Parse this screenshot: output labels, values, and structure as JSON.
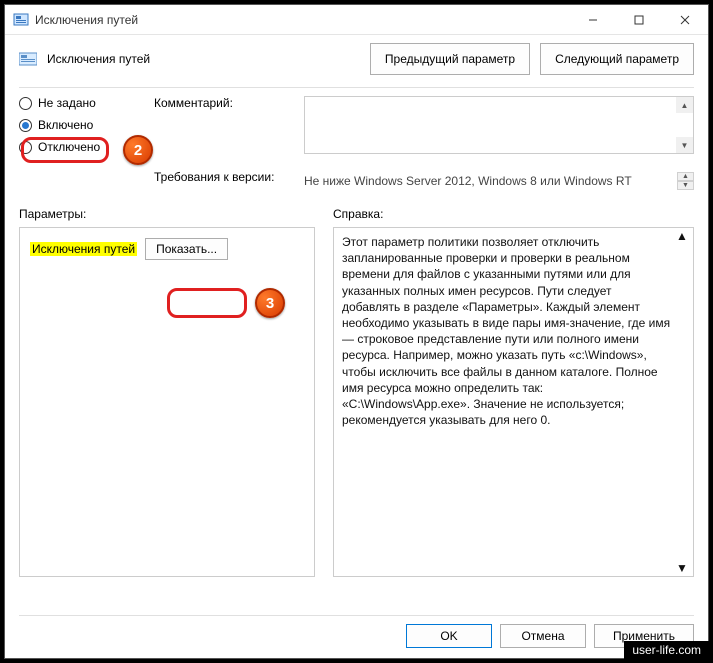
{
  "window": {
    "title": "Исключения путей"
  },
  "toolbar": {
    "label": "Исключения путей",
    "prev": "Предыдущий параметр",
    "next": "Следующий параметр"
  },
  "radios": {
    "not_configured": "Не задано",
    "enabled": "Включено",
    "disabled": "Отключено",
    "selected": "enabled"
  },
  "meta": {
    "comment_label": "Комментарий:",
    "comment_value": "",
    "req_label": "Требования к версии:",
    "req_value": "Не ниже Windows Server 2012, Windows 8 или Windows RT"
  },
  "params": {
    "section": "Параметры:",
    "item_name": "Исключения путей",
    "show_button": "Показать..."
  },
  "help": {
    "section": "Справка:",
    "text": "Этот параметр политики позволяет отключить запланированные проверки и проверки в реальном времени для файлов с указанными путями или для указанных полных имен ресурсов. Пути следует добавлять в разделе «Параметры». Каждый элемент необходимо указывать в виде пары имя-значение, где имя — строковое представление пути или полного имени ресурса. Например, можно указать путь «c:\\Windows», чтобы исключить все файлы в данном каталоге. Полное имя ресурса можно определить так: «C:\\Windows\\App.exe». Значение не используется; рекомендуется указывать для него 0."
  },
  "footer": {
    "ok": "OK",
    "cancel": "Отмена",
    "apply": "Применить"
  },
  "markers": {
    "m2": "2",
    "m3": "3"
  },
  "watermark": "user-life.com"
}
